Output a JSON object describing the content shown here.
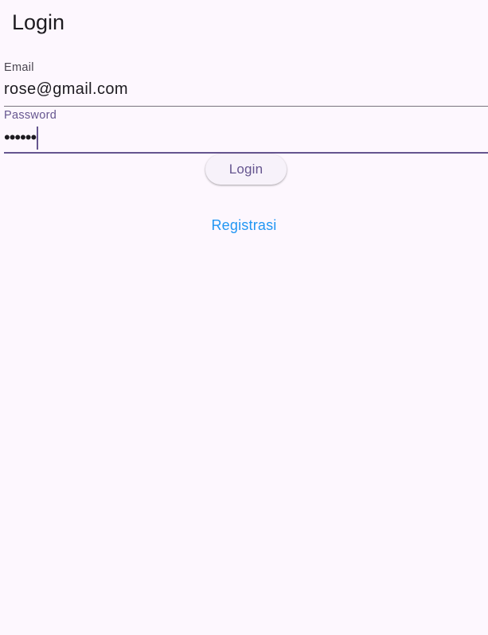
{
  "app_bar": {
    "title": "Login"
  },
  "form": {
    "email": {
      "label": "Email",
      "value": "rose@gmail.com"
    },
    "password": {
      "label": "Password",
      "masked_value": "••••••"
    },
    "submit_label": "Login",
    "register_label": "Registrasi"
  },
  "colors": {
    "background": "#fdf7fe",
    "primary": "#65558f",
    "link": "#2196f3",
    "text": "#1d1b20"
  }
}
